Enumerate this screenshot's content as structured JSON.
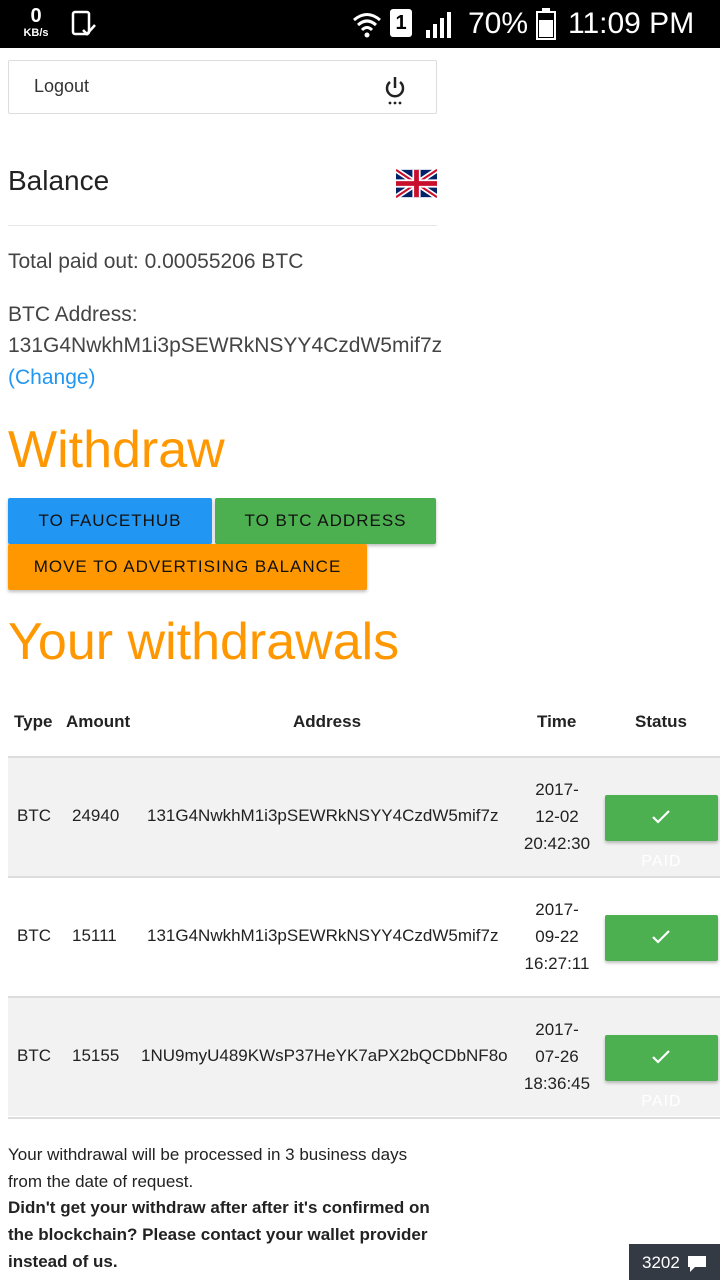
{
  "status_bar": {
    "kbs_value": "0",
    "kbs_unit": "KB/s",
    "sim_slot": "1",
    "battery": "70%",
    "time": "11:09 PM"
  },
  "logout": {
    "label": "Logout",
    "icon": "power-icon"
  },
  "balance": {
    "title": "Balance",
    "language_icon": "uk-flag-icon",
    "total_paid": "Total paid out: 0.00055206 BTC",
    "btc_address_label": "BTC Address:",
    "btc_address": "131G4NwkhM1i3pSEWRkNSYY4CzdW5mif7z",
    "change_link": "(Change)"
  },
  "withdraw": {
    "title": "Withdraw",
    "buttons": {
      "faucethub": "TO FAUCETHUB",
      "btc_address": "TO BTC ADDRESS",
      "advertising": "MOVE TO ADVERTISING BALANCE"
    }
  },
  "withdrawals": {
    "title": "Your withdrawals",
    "columns": [
      "Type",
      "Amount",
      "Address",
      "Time",
      "Status"
    ],
    "rows": [
      {
        "type": "BTC",
        "amount": "24940",
        "address": "131G4NwkhM1i3pSEWRkNSYY4CzdW5mif7z",
        "time_1": "2017-",
        "time_2": "12-02",
        "time_3": "20:42:30",
        "status": "PAID"
      },
      {
        "type": "BTC",
        "amount": "15111",
        "address": "131G4NwkhM1i3pSEWRkNSYY4CzdW5mif7z",
        "time_1": "2017-",
        "time_2": "09-22",
        "time_3": "16:27:11",
        "status": "PAID"
      },
      {
        "type": "BTC",
        "amount": "15155",
        "address": "1NU9myU489KWsP37HeYK7aPX2bQCDbNF8o",
        "time_1": "2017-",
        "time_2": "07-26",
        "time_3": "18:36:45",
        "status": "PAID"
      }
    ]
  },
  "notes": {
    "processing_1": "Your withdrawal will be processed in 3 business days",
    "processing_2": "from the date of request.",
    "contact_1": "Didn't get your withdraw after after it's confirmed on",
    "contact_2": "the blockchain? Please contact your wallet provider",
    "contact_3": "instead of us."
  },
  "chat": {
    "count": "3202",
    "icon": "chat-bubble-icon"
  },
  "colors": {
    "accent_orange": "#ff9800",
    "blue": "#2196f3",
    "green": "#4caf50",
    "link": "#2196f3"
  }
}
